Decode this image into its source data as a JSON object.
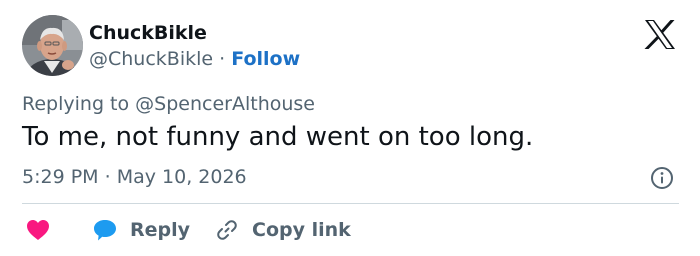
{
  "author": {
    "display_name": "ChuckBikle",
    "handle": "@ChuckBikle",
    "separator": "·",
    "follow_label": "Follow"
  },
  "replying": {
    "prefix": "Replying to",
    "target": "@SpencerAlthouse"
  },
  "tweet": {
    "text": "To me, not funny and went on too long.",
    "time": "5:29 PM",
    "date_separator": "·",
    "date": "May 10, 2026"
  },
  "actions": {
    "reply_label": "Reply",
    "copy_link_label": "Copy link"
  },
  "icons": {
    "brand": "x-logo-icon",
    "info": "info-icon",
    "like": "heart-icon",
    "reply": "speech-bubble-icon",
    "copy": "link-icon"
  },
  "colors": {
    "text": "#0f1419",
    "secondary": "#536471",
    "follow": "#1d71c6",
    "like": "#f91880",
    "reply_icon": "#1d9bf0",
    "divider": "#cfd9de"
  }
}
